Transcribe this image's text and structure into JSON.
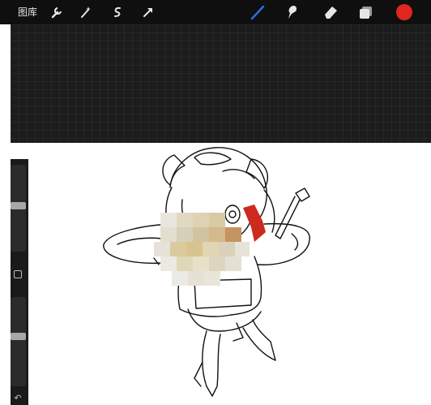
{
  "toolbar": {
    "gallery_label": "图库",
    "left_tools": [
      "wrench-icon",
      "magic-wand-icon",
      "selection-icon",
      "transform-arrow-icon"
    ],
    "right_tools": [
      "brush-icon",
      "smudge-icon",
      "eraser-icon",
      "layers-icon"
    ],
    "active_tool": "brush-icon",
    "current_color": "#e0261f",
    "brush_color": "#2f6fe6"
  },
  "sidebar": {
    "sliders": [
      "brush-size-slider",
      "opacity-slider"
    ],
    "modifier": "modifier-button",
    "undo": "↶"
  },
  "canvas": {
    "upper_background": "#1c1c1c",
    "lower_background": "#ffffff",
    "content": "chibi-character-lineart",
    "censored_area": "mosaic-blur"
  }
}
